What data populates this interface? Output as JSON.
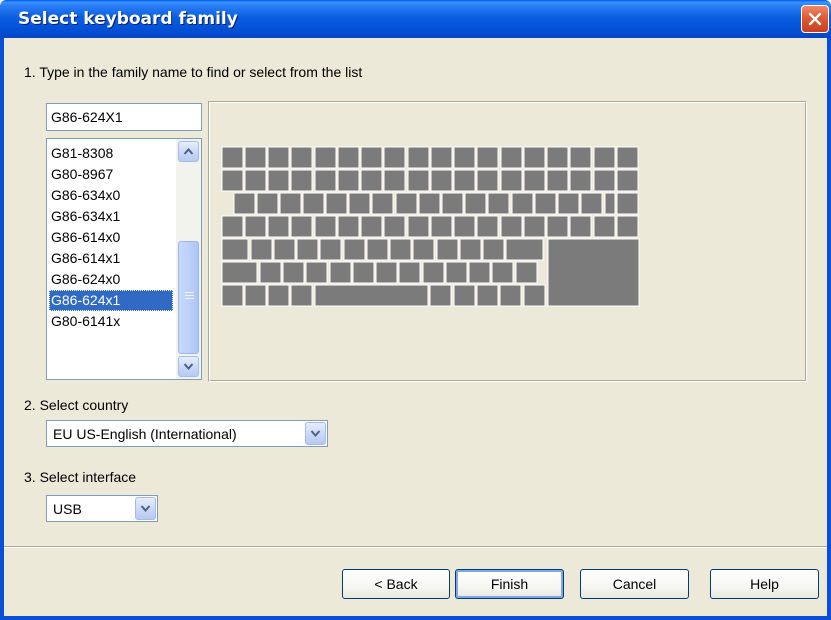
{
  "window": {
    "title": "Select keyboard family"
  },
  "steps": {
    "step1_label": "1.  Type in the family name to find or select from the list",
    "step2_label": "2. Select country",
    "step3_label": "3. Select interface"
  },
  "family": {
    "search_value": "G86-624X1",
    "list": [
      "G81-8308",
      "G80-8967",
      "G86-634x0",
      "G86-634x1",
      "G86-614x0",
      "G86-614x1",
      "G86-624x0",
      "G86-624x1",
      "G80-6141x"
    ],
    "selected": "G86-624x1"
  },
  "country": {
    "selected": "EU US-English (International)"
  },
  "interface": {
    "selected": "USB"
  },
  "buttons": {
    "back": "< Back",
    "finish": "Finish",
    "cancel": "Cancel",
    "help": "Help"
  },
  "colors": {
    "key_fill": "#7b7b7b",
    "key_border": "#ffffff",
    "selection": "#316ac5",
    "titlebar": "#0a5fe0",
    "dialog_bg": "#ece9d8"
  }
}
